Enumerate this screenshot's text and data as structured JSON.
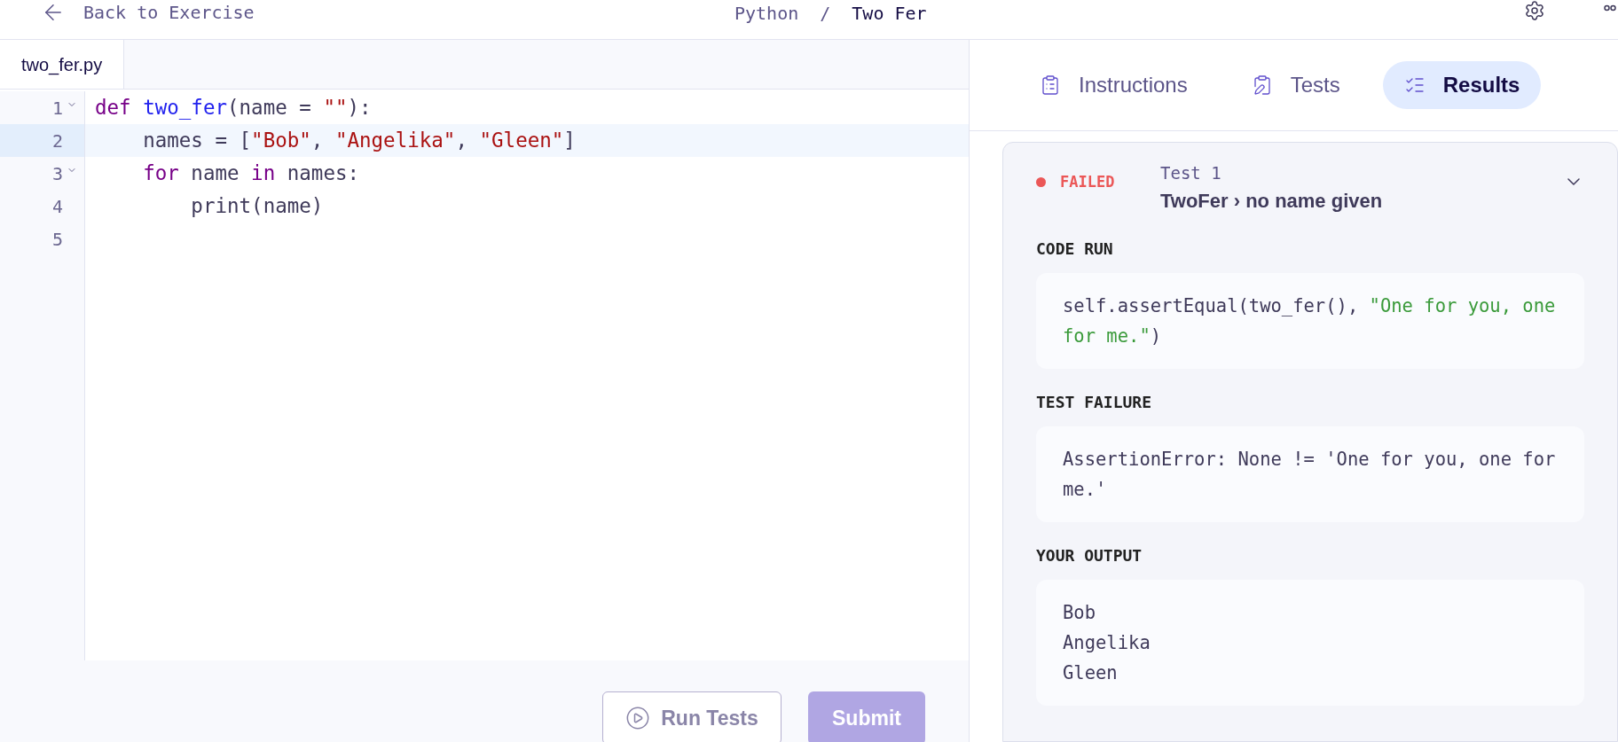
{
  "top_bar": {
    "back_link": "Back to Exercise",
    "breadcrumb": [
      "Python",
      "Two Fer"
    ],
    "separator": "/"
  },
  "editor": {
    "file_tab": {
      "label": "two_fer.py"
    },
    "lines": [
      {
        "number": "1",
        "foldable": true,
        "selected": false,
        "tokens": [
          {
            "kind": "keyword",
            "text": "def "
          },
          {
            "kind": "function",
            "text": "two_fer"
          },
          {
            "kind": "plain",
            "text": "(name = "
          },
          {
            "kind": "string",
            "text": "\"\""
          },
          {
            "kind": "plain",
            "text": "):"
          }
        ]
      },
      {
        "number": "2",
        "foldable": false,
        "selected": true,
        "tokens": [
          {
            "kind": "plain",
            "text": "    names = ["
          },
          {
            "kind": "string",
            "text": "\"Bob\""
          },
          {
            "kind": "plain",
            "text": ", "
          },
          {
            "kind": "string",
            "text": "\"Angelika\""
          },
          {
            "kind": "plain",
            "text": ", "
          },
          {
            "kind": "string",
            "text": "\"Gleen\""
          },
          {
            "kind": "plain",
            "text": "]"
          }
        ]
      },
      {
        "number": "3",
        "foldable": true,
        "selected": false,
        "tokens": [
          {
            "kind": "keyword",
            "text": "    for"
          },
          {
            "kind": "plain",
            "text": " name "
          },
          {
            "kind": "keyword",
            "text": "in"
          },
          {
            "kind": "plain",
            "text": " names:"
          }
        ]
      },
      {
        "number": "4",
        "foldable": false,
        "selected": false,
        "tokens": [
          {
            "kind": "plain",
            "text": "        print(name)"
          }
        ]
      },
      {
        "number": "5",
        "foldable": false,
        "selected": false
      }
    ],
    "buttons": [
      {
        "kind": "run",
        "label": "Run Tests",
        "disabled": true
      },
      {
        "kind": "submit",
        "label": "Submit",
        "disabled": true
      }
    ]
  },
  "panel": {
    "tabs": [
      {
        "kind": "instructions",
        "label": "Instructions",
        "selected": false
      },
      {
        "kind": "tests",
        "label": "Tests",
        "selected": false
      },
      {
        "kind": "results",
        "label": "Results",
        "selected": true
      }
    ],
    "test": {
      "status": "FAILED",
      "failed": true,
      "title": "Test 1",
      "name": "TwoFer › no name given",
      "expanded": true,
      "sections": [
        {
          "heading": "CODE RUN",
          "tokens": [
            {
              "kind": "plain",
              "text": "self.assertEqual(two_fer(), "
            },
            {
              "kind": "green",
              "text": "\"One for you, one for me.\""
            },
            {
              "kind": "plain",
              "text": ")"
            }
          ]
        },
        {
          "heading": "TEST FAILURE",
          "tokens": [
            {
              "kind": "plain",
              "text": "AssertionError: None != 'One for you, one for me.'"
            }
          ]
        },
        {
          "heading": "YOUR OUTPUT",
          "tokens": [
            {
              "kind": "plain",
              "text": "Bob\nAngelika\nGleen"
            }
          ]
        }
      ]
    }
  }
}
